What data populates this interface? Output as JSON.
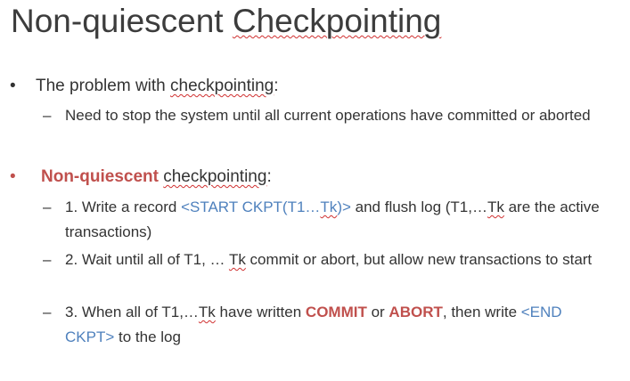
{
  "title": {
    "plain": "Non-quiescent ",
    "underlined": "Checkpointing"
  },
  "bullets": [
    {
      "marker": "•",
      "prefix": "The problem with ",
      "underlined": "checkpointing",
      "suffix": ":",
      "sub": [
        {
          "marker": "–",
          "text": "Need to stop the system until all current operations have committed or aborted"
        }
      ]
    },
    {
      "marker": "•",
      "highlight": "Non-quiescent",
      "space": " ",
      "underlined": "checkpointing",
      "suffix": ":",
      "sub": [
        {
          "marker": "–",
          "t1": "1. Write a record ",
          "b1": "<START CKPT(T1…",
          "b2": "Tk",
          "b3": ")>",
          "t2": " and flush log (T1,…",
          "u1": "Tk",
          "t3": " are the active transactions)"
        },
        {
          "marker": "–",
          "t1": "2. Wait until all of T1, … ",
          "u1": "Tk",
          "t2": " commit or abort, but allow new transactions to start"
        },
        {
          "marker": "–",
          "t1": "3. When all of T1,…",
          "u1": "Tk",
          "t2": " have written ",
          "r1": "COMMIT",
          "t3": " or ",
          "r2": "ABORT",
          "t4": ", then write ",
          "b1": "<END CKPT>",
          "t5": " to the log"
        }
      ]
    }
  ],
  "colors": {
    "title": "#3c3c3c",
    "text": "#333333",
    "accent_red": "#c0504d",
    "accent_blue": "#4f81bd",
    "spellcheck": "#d03030"
  }
}
